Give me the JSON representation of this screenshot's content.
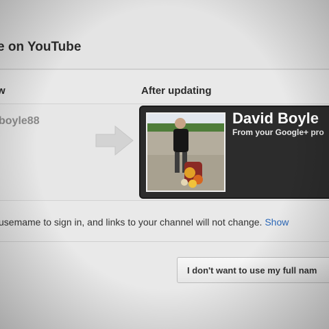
{
  "dialog": {
    "title": "e on YouTube"
  },
  "columns": {
    "now_label": "w",
    "after_label": "After updating"
  },
  "current": {
    "username": "boyle88"
  },
  "preview": {
    "name": "David Boyle",
    "subtitle": "From your Google+ pro"
  },
  "info": {
    "text": "usemame to sign in, and links to your channel will not change.",
    "link": "Show"
  },
  "actions": {
    "decline_label": "I don't want to use my full nam"
  },
  "colors": {
    "card_background": "#2c2c2c",
    "link": "#2a67b8"
  },
  "icons": [
    "arrow-right-icon"
  ]
}
